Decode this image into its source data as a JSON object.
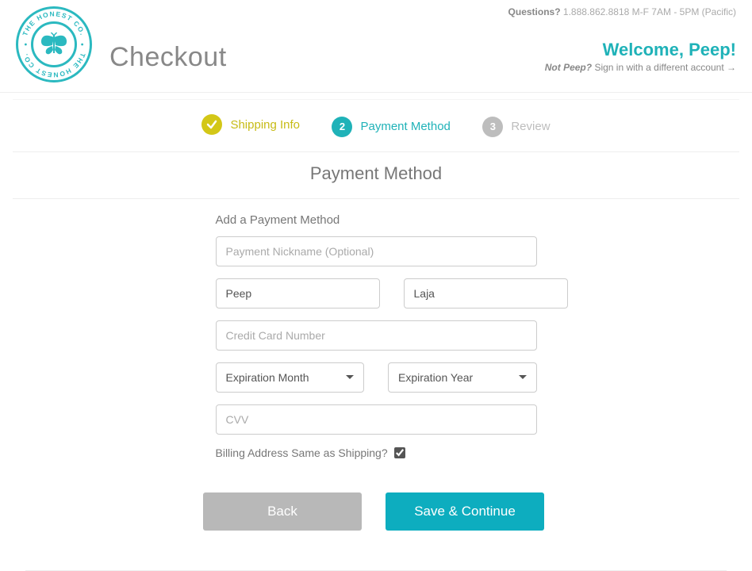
{
  "brand": {
    "name": "THE HONEST CO."
  },
  "header": {
    "title": "Checkout",
    "questions_label": "Questions?",
    "questions_info": "1.888.862.8818 M-F 7AM - 5PM (Pacific)",
    "welcome": "Welcome, Peep!",
    "not_you_prefix": "Not Peep?",
    "not_you_action": "Sign in with a different account"
  },
  "steps": {
    "s1": {
      "label": "Shipping Info"
    },
    "s2": {
      "num": "2",
      "label": "Payment Method"
    },
    "s3": {
      "num": "3",
      "label": "Review"
    }
  },
  "section": {
    "title": "Payment Method",
    "subhead": "Add a Payment Method"
  },
  "form": {
    "nickname_placeholder": "Payment Nickname (Optional)",
    "first_name": "Peep",
    "last_name": "Laja",
    "cc_placeholder": "Credit Card Number",
    "exp_month_label": "Expiration Month",
    "exp_year_label": "Expiration Year",
    "cvv_placeholder": "CVV",
    "billing_same": "Billing Address Same as Shipping?"
  },
  "buttons": {
    "back": "Back",
    "save": "Save & Continue"
  }
}
